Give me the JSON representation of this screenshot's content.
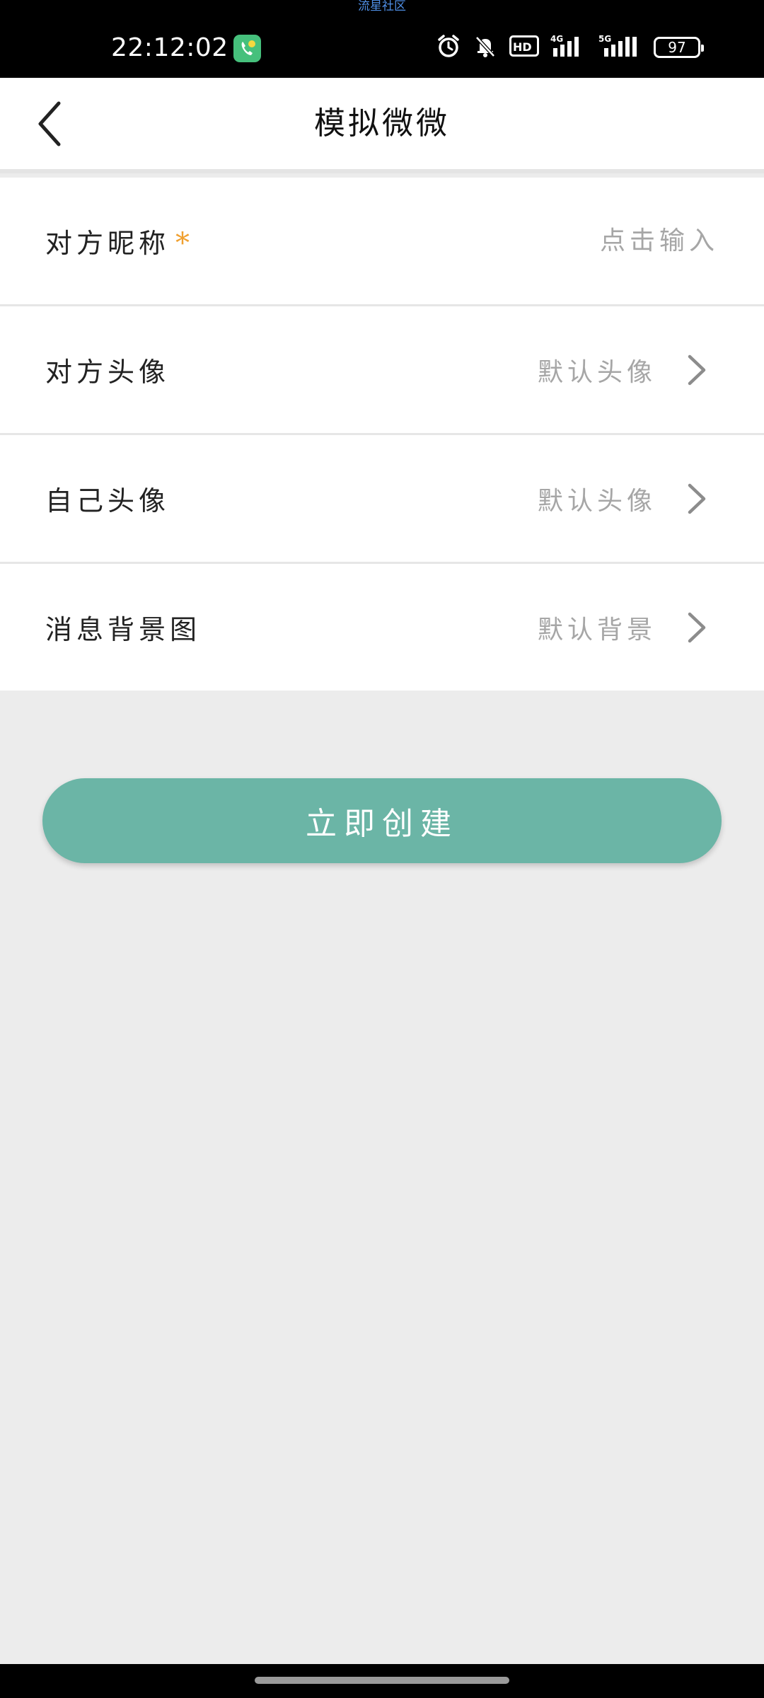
{
  "status_bar": {
    "watermark": "流星社区",
    "time": "22:12:02",
    "network_label_1": "HD",
    "network_label_2": "4G",
    "network_label_3": "5G",
    "battery": "97"
  },
  "header": {
    "title": "模拟微微"
  },
  "form": {
    "nickname": {
      "label": "对方昵称",
      "required_mark": "*",
      "placeholder": "点击输入"
    },
    "peer_avatar": {
      "label": "对方头像",
      "value": "默认头像"
    },
    "self_avatar": {
      "label": "自己头像",
      "value": "默认头像"
    },
    "background": {
      "label": "消息背景图",
      "value": "默认背景"
    }
  },
  "actions": {
    "create_label": "立即创建"
  },
  "colors": {
    "accent": "#6bb5a6",
    "required": "#f0a030",
    "page_bg": "#ececec"
  }
}
